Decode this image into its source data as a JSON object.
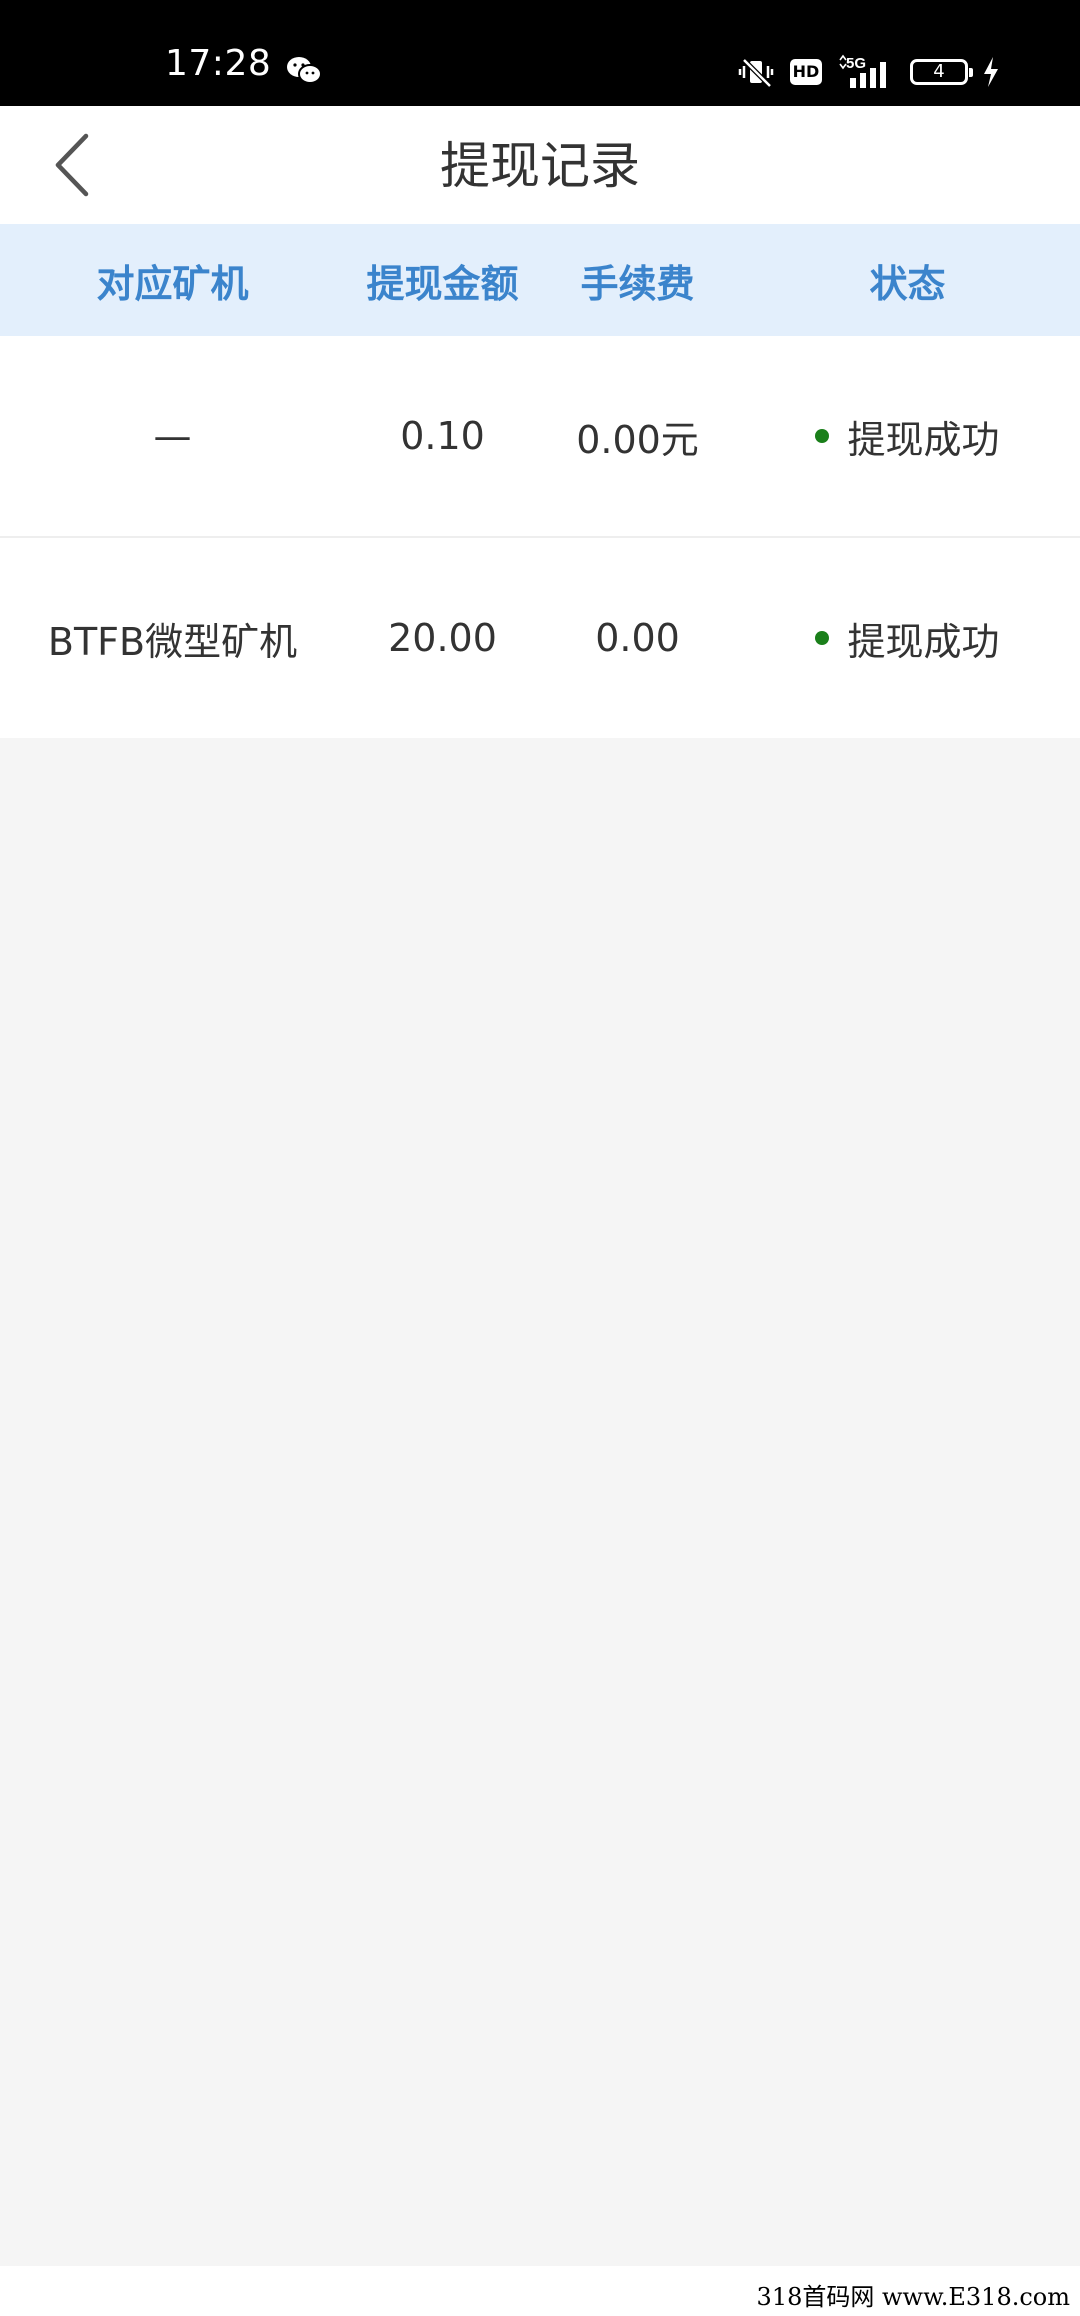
{
  "status_bar": {
    "time": "17:28",
    "hd": "HD",
    "network": "5G",
    "battery": "4"
  },
  "nav": {
    "title": "提现记录"
  },
  "table": {
    "headers": [
      "对应矿机",
      "提现金额",
      "手续费",
      "状态"
    ],
    "rows": [
      {
        "machine": "—",
        "amount": "0.10",
        "fee": "0.00元",
        "status": "提现成功"
      },
      {
        "machine": "BTFB微型矿机",
        "amount": "20.00",
        "fee": "0.00",
        "status": "提现成功"
      }
    ]
  },
  "watermark": "318首码网 www.E318.com",
  "colors": {
    "header_bg": "#e3effc",
    "header_text": "#3b84cc",
    "success": "#1a7f1a"
  }
}
